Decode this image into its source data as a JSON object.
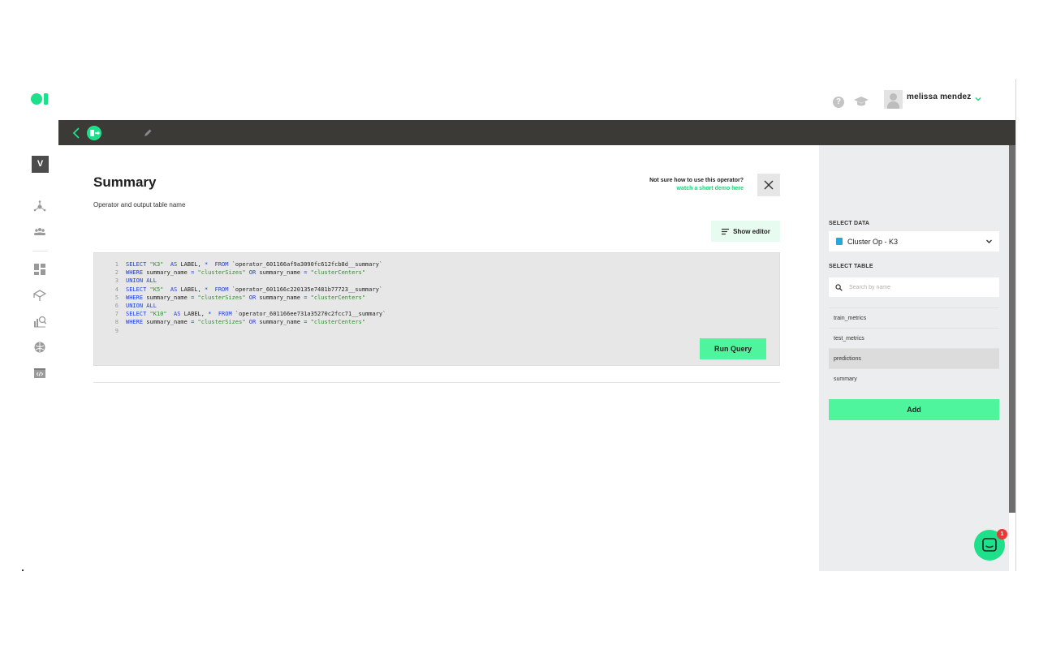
{
  "app": {
    "logo_icon": "brand-logo",
    "accent_color": "#1fe08a"
  },
  "header": {
    "user_name": "melissa mendez",
    "icons": [
      "help-icon",
      "graduation-cap-icon",
      "avatar",
      "chevron-down-icon"
    ]
  },
  "toolbar": {
    "icons": [
      "chevron-left-icon",
      "operator-icon",
      "pencil-icon"
    ]
  },
  "rail": {
    "badge": "V",
    "icons": [
      "network-icon",
      "users-icon",
      "dashboard-icon",
      "model-icon",
      "analysis-icon",
      "brain-icon",
      "code-icon"
    ]
  },
  "main": {
    "title": "Summary",
    "subtitle": "Operator and output table name",
    "help_text": "Not sure how to use this operator?",
    "help_link": "watch a short demo here",
    "show_editor_label": "Show editor",
    "run_query_label": "Run Query",
    "code": [
      {
        "n": "1",
        "p": [
          [
            "kw",
            "SELECT "
          ],
          [
            "str",
            "\"K3\""
          ],
          [
            "tx",
            "  "
          ],
          [
            "kw",
            "AS"
          ],
          [
            "tx",
            " LABEL, "
          ],
          [
            "kw",
            "*"
          ],
          [
            "tx",
            "  "
          ],
          [
            "kw",
            "FROM"
          ],
          [
            "tx",
            " `operator_601166af9a3090fc612fcb8d__summary`"
          ]
        ]
      },
      {
        "n": "2",
        "p": [
          [
            "kw",
            "WHERE"
          ],
          [
            "tx",
            " summary_name "
          ],
          [
            "kw",
            "="
          ],
          [
            "tx",
            " "
          ],
          [
            "str",
            "\"clusterSizes\""
          ],
          [
            "tx",
            " "
          ],
          [
            "kw",
            "OR"
          ],
          [
            "tx",
            " summary_name "
          ],
          [
            "kw",
            "="
          ],
          [
            "tx",
            " "
          ],
          [
            "str",
            "\"clusterCenters\""
          ]
        ]
      },
      {
        "n": "3",
        "p": [
          [
            "kw",
            "UNION ALL"
          ]
        ]
      },
      {
        "n": "4",
        "p": [
          [
            "kw",
            "SELECT "
          ],
          [
            "str",
            "\"K5\""
          ],
          [
            "tx",
            "  "
          ],
          [
            "kw",
            "AS"
          ],
          [
            "tx",
            " LABEL, "
          ],
          [
            "kw",
            "*"
          ],
          [
            "tx",
            "  "
          ],
          [
            "kw",
            "FROM"
          ],
          [
            "tx",
            " `operator_601166c220135e7481b77723__summary`"
          ]
        ]
      },
      {
        "n": "5",
        "p": [
          [
            "kw",
            "WHERE"
          ],
          [
            "tx",
            " summary_name "
          ],
          [
            "kw",
            "="
          ],
          [
            "tx",
            " "
          ],
          [
            "str",
            "\"clusterSizes\""
          ],
          [
            "tx",
            " "
          ],
          [
            "kw",
            "OR"
          ],
          [
            "tx",
            " summary_name "
          ],
          [
            "kw",
            "="
          ],
          [
            "tx",
            " "
          ],
          [
            "str",
            "\"clusterCenters\""
          ]
        ]
      },
      {
        "n": "6",
        "p": [
          [
            "kw",
            "UNION ALL"
          ]
        ]
      },
      {
        "n": "7",
        "p": [
          [
            "kw",
            "SELECT "
          ],
          [
            "str",
            "\"K10\""
          ],
          [
            "tx",
            "  "
          ],
          [
            "kw",
            "AS"
          ],
          [
            "tx",
            " LABEL, "
          ],
          [
            "kw",
            "*"
          ],
          [
            "tx",
            "  "
          ],
          [
            "kw",
            "FROM"
          ],
          [
            "tx",
            " `operator_601166ee731a35270c2fcc71__summary`"
          ]
        ]
      },
      {
        "n": "8",
        "p": [
          [
            "kw",
            "WHERE"
          ],
          [
            "tx",
            " summary_name "
          ],
          [
            "kw",
            "="
          ],
          [
            "tx",
            " "
          ],
          [
            "str",
            "\"clusterSizes\""
          ],
          [
            "tx",
            " "
          ],
          [
            "kw",
            "OR"
          ],
          [
            "tx",
            " summary_name "
          ],
          [
            "kw",
            "="
          ],
          [
            "tx",
            " "
          ],
          [
            "str",
            "\"clusterCenters\""
          ]
        ]
      },
      {
        "n": "9",
        "p": []
      }
    ]
  },
  "panel": {
    "select_data_label": "SELECT DATA",
    "selected_data": "Cluster Op - K3",
    "select_table_label": "SELECT TABLE",
    "search_placeholder": "Search by name",
    "tables": [
      {
        "name": "train_metrics",
        "selected": false
      },
      {
        "name": "test_metrics",
        "selected": false
      },
      {
        "name": "predictions",
        "selected": true
      },
      {
        "name": "summary",
        "selected": false
      }
    ],
    "add_label": "Add"
  },
  "chat": {
    "badge_count": "1"
  }
}
